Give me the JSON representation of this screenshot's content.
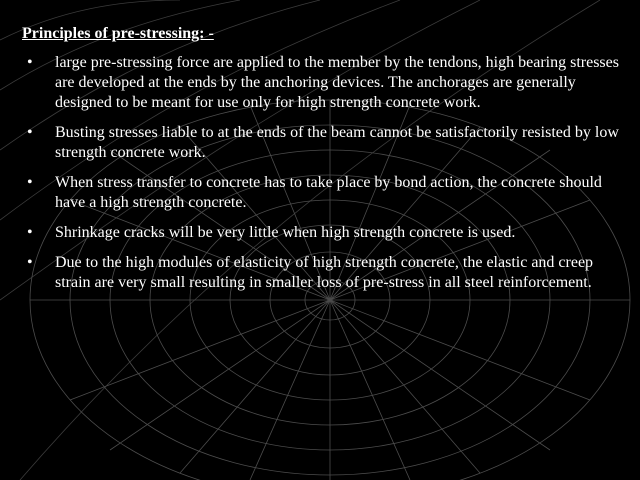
{
  "slide": {
    "title": "Principles of pre-stressing: -",
    "bullet_symbol": "•",
    "bullets": [
      "large pre-stressing force are applied to the member by the tendons, high bearing stresses are developed at the ends by the anchoring devices. The anchorages are generally designed to be meant for use only for high strength concrete work.",
      "Busting stresses liable to at the ends of the beam cannot be satisfactorily resisted by low strength concrete work.",
      "When stress transfer to concrete has to take place by bond action, the concrete should have a high strength concrete.",
      "Shrinkage cracks will be very little when high strength concrete is used.",
      " Due to the high modules of elasticity of high strength concrete, the elastic and creep strain are very small resulting in smaller loss of pre-stress in all steel reinforcement."
    ]
  },
  "colors": {
    "background": "#000000",
    "text": "#ffffff",
    "grid_lines": "#5a5a5a"
  }
}
